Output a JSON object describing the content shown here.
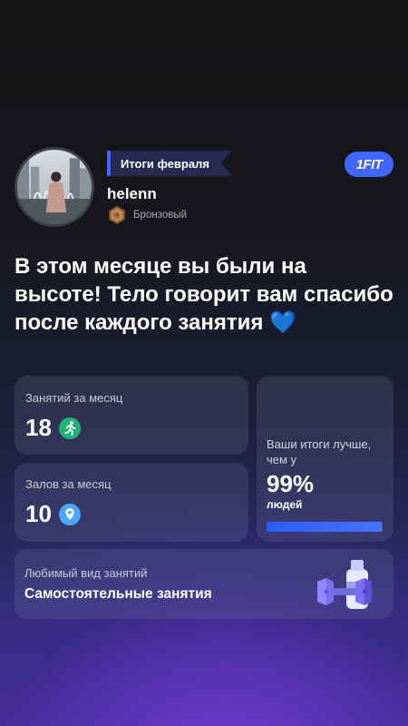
{
  "header": {
    "month_badge": "Итоги февраля",
    "brand": "1FIT",
    "username": "helenn",
    "tier": "Бронзовый"
  },
  "headline": {
    "text": "В этом месяце вы были на высоте! Тело говорит вам спасибо после каждого занятия",
    "emoji": "💙"
  },
  "stats": {
    "sessions": {
      "label": "Занятий за месяц",
      "value": "18",
      "icon": "running-person-icon"
    },
    "gyms": {
      "label": "Залов за месяц",
      "value": "10",
      "icon": "location-pin-icon"
    }
  },
  "result": {
    "text": "Ваши итоги лучше, чем у",
    "percent": "99%",
    "people": "людей",
    "progress": 0.99
  },
  "favorite": {
    "label": "Любимый вид занятий",
    "value": "Самостоятельные занятия",
    "icon": "dumbbell-bottle-icon"
  },
  "colors": {
    "accent": "#3f66ff",
    "card_bg": "rgba(120,124,165,0.22)",
    "heart": "#3b8cff",
    "sessions_icon": "#22b27a",
    "gyms_icon": "#4aa9ff",
    "tier_badge": "#b7844f"
  }
}
